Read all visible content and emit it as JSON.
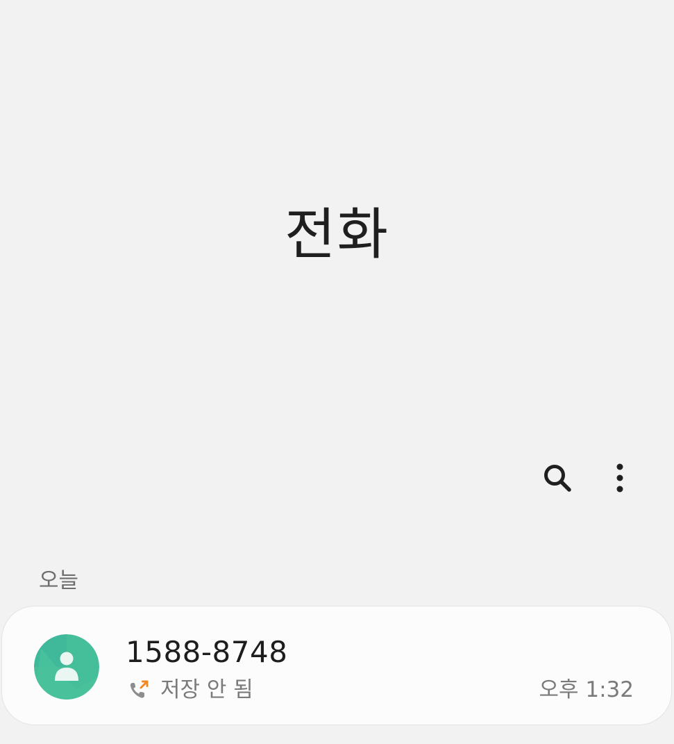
{
  "app": {
    "title": "전화"
  },
  "toolbar": {
    "search_icon": "search-icon",
    "more_icon": "more-vertical-icon"
  },
  "sections": [
    {
      "header": "오늘",
      "calls": [
        {
          "number": "1588-8748",
          "status": "저장 안 됨",
          "time": "오후 1:32",
          "call_type_icon": "outgoing-call-icon",
          "avatar_icon": "default-contact-avatar"
        }
      ]
    }
  ],
  "colors": {
    "background": "#f2f2f2",
    "card": "#fcfcfc",
    "avatar_green": "#45bf9a",
    "outgoing_arrow": "#f08a24"
  }
}
